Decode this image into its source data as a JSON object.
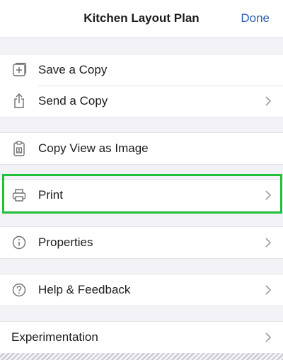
{
  "header": {
    "title": "Kitchen Layout Plan",
    "done_label": "Done"
  },
  "menu": {
    "save_copy": "Save a Copy",
    "send_copy": "Send a Copy",
    "copy_view_image": "Copy View as Image",
    "print": "Print",
    "properties": "Properties",
    "help_feedback": "Help & Feedback",
    "experimentation": "Experimentation"
  },
  "icons": {
    "save_copy": "plus-square-icon",
    "send_copy": "share-icon",
    "copy_view_image": "clipboard-image-icon",
    "print": "printer-icon",
    "properties": "info-icon",
    "help_feedback": "help-icon",
    "chevron": "chevron-right-icon"
  },
  "colors": {
    "accent": "#2f5bb7",
    "highlight": "#22c13c",
    "background": "#f2f2f7",
    "icon": "#6e6e73",
    "chevron": "#9a9aa0"
  }
}
